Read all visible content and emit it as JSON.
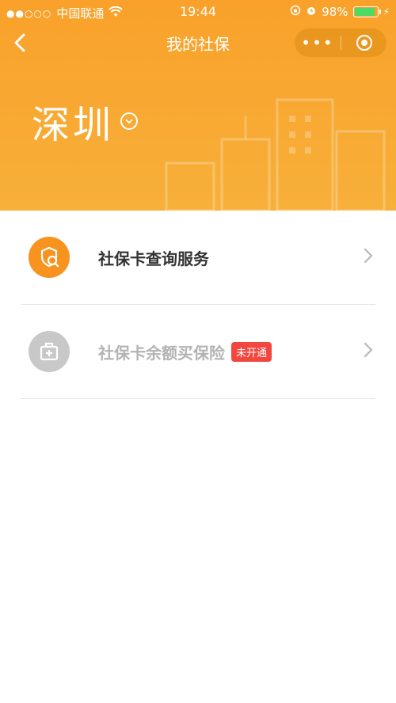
{
  "status_bar": {
    "signal": "●●○○○",
    "carrier": "中国联通",
    "wifi_icon": "wifi-icon",
    "time": "19:44",
    "battery_percent": "98%",
    "battery_level": 0.98
  },
  "nav": {
    "title": "我的社保",
    "back_icon": "back-icon",
    "more_icon": "more-icon",
    "target_icon": "close-target-icon"
  },
  "hero": {
    "city": "深圳",
    "city_dropdown_icon": "chevron-down-icon"
  },
  "menu": [
    {
      "label": "社保卡查询服务",
      "icon": "search-shield-icon",
      "enabled": true
    },
    {
      "label": "社保卡余额买保险",
      "icon": "medical-kit-icon",
      "badge": "未开通",
      "enabled": false
    }
  ],
  "colors": {
    "header": "#f9a12a",
    "accent": "#f7931e",
    "badge": "#f2473e",
    "disabled": "#b3b3b3"
  }
}
